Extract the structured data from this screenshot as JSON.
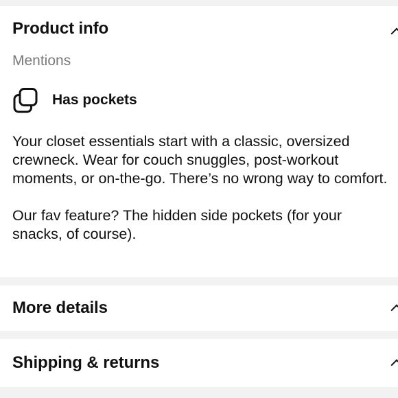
{
  "product_info": {
    "title": "Product info",
    "mentions_label": "Mentions",
    "feature": {
      "icon": "copy-squares-icon",
      "label": "Has pockets"
    },
    "description": [
      "Your closet essentials start with a classic, oversized crewneck. Wear for couch snuggles, post-workout moments, or on-the-go. There’s no wrong way to comfort.",
      "Our fav feature? The hidden side pockets (for your snacks, of course)."
    ]
  },
  "more_details": {
    "title": "More details"
  },
  "shipping_returns": {
    "title": "Shipping & returns"
  }
}
